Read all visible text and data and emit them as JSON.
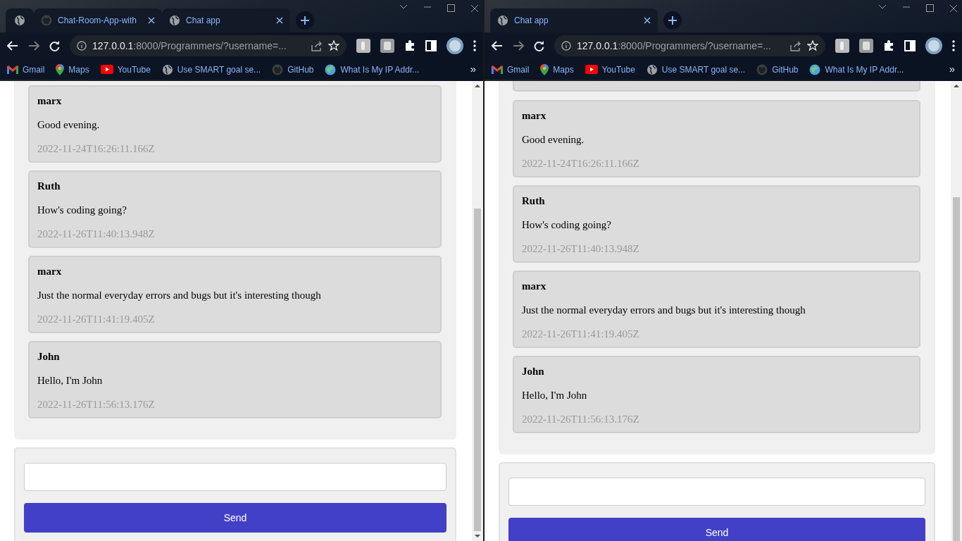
{
  "windows": [
    {
      "tabs": [
        {
          "kind": "pinned"
        },
        {
          "kind": "repo",
          "title": "Chat-Room-App-with"
        },
        {
          "kind": "page",
          "title": "Chat app"
        }
      ],
      "address": {
        "host": "127.0.0.1",
        "rest": ":8000/Programmers/?username=..."
      },
      "bookmarks": [
        {
          "label": "Gmail"
        },
        {
          "label": "Maps"
        },
        {
          "label": "YouTube"
        },
        {
          "label": "Use SMART goal se..."
        },
        {
          "label": "GitHub"
        },
        {
          "label": "What Is My IP Addr..."
        }
      ],
      "bookmarks_overflow": "»",
      "chat": {
        "partial_message_above": false,
        "messages": [
          {
            "user": "marx",
            "text": "Good evening.",
            "time": "2022-11-24T16:26:11.166Z"
          },
          {
            "user": "Ruth",
            "text": "How's coding going?",
            "time": "2022-11-26T11:40:13.948Z"
          },
          {
            "user": "marx",
            "text": "Just the normal everyday errors and bugs but it's interesting though",
            "time": "2022-11-26T11:41:19.405Z"
          },
          {
            "user": "John",
            "text": "Hello, I'm John",
            "time": "2022-11-26T11:56:13.176Z"
          }
        ]
      },
      "send_button": "Send"
    },
    {
      "tabs": [
        {
          "kind": "page",
          "title": "Chat app"
        }
      ],
      "address": {
        "host": "127.0.0.1",
        "rest": ":8000/Programmers/?username=..."
      },
      "bookmarks": [
        {
          "label": "Gmail"
        },
        {
          "label": "Maps"
        },
        {
          "label": "YouTube"
        },
        {
          "label": "Use SMART goal se..."
        },
        {
          "label": "GitHub"
        },
        {
          "label": "What Is My IP Addr..."
        }
      ],
      "bookmarks_overflow": "»",
      "chat": {
        "partial_message_above": true,
        "messages": [
          {
            "user": "marx",
            "text": "Good evening.",
            "time": "2022-11-24T16:26:11.166Z"
          },
          {
            "user": "Ruth",
            "text": "How's coding going?",
            "time": "2022-11-26T11:40:13.948Z"
          },
          {
            "user": "marx",
            "text": "Just the normal everyday errors and bugs but it's interesting though",
            "time": "2022-11-26T11:41:19.405Z"
          },
          {
            "user": "John",
            "text": "Hello, I'm John",
            "time": "2022-11-26T11:56:13.176Z"
          }
        ]
      },
      "send_button": "Send"
    }
  ]
}
